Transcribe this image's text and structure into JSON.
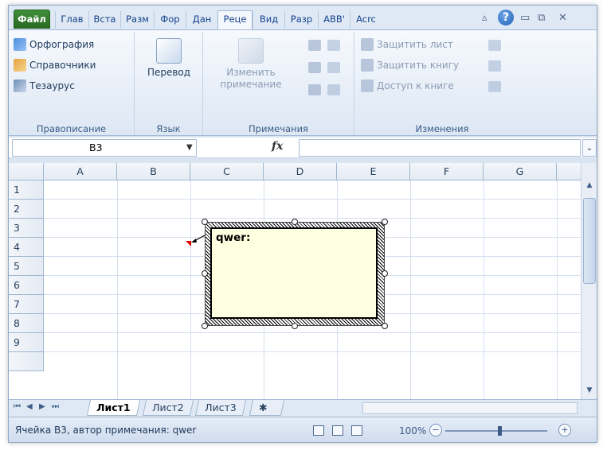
{
  "ribbon_tabs": [
    {
      "label": "Файл"
    },
    {
      "label": "Глав"
    },
    {
      "label": "Вста"
    },
    {
      "label": "Разм"
    },
    {
      "label": "Фор"
    },
    {
      "label": "Дан"
    },
    {
      "label": "Реце"
    },
    {
      "label": "Вид"
    },
    {
      "label": "Разр"
    },
    {
      "label": "ABB'"
    },
    {
      "label": "Acrc"
    }
  ],
  "active_tab": "Реце",
  "ribbon": {
    "proofing": {
      "spelling": "Орфография",
      "research": "Справочники",
      "thesaurus": "Тезаурус",
      "group_label": "Правописание"
    },
    "language": {
      "translate": "Перевод",
      "group_label": "Язык"
    },
    "comments": {
      "edit_comment_line1": "Изменить",
      "edit_comment_line2": "примечание",
      "group_label": "Примечания"
    },
    "changes": {
      "protect_sheet": "Защитить лист",
      "protect_workbook": "Защитить книгу",
      "share_workbook": "Доступ к книге",
      "group_label": "Изменения"
    }
  },
  "formula_bar": {
    "name_box": "B3",
    "fx_symbol": "fx",
    "formula": ""
  },
  "columns": [
    "A",
    "B",
    "C",
    "D",
    "E",
    "F",
    "G"
  ],
  "rows": [
    "1",
    "2",
    "3",
    "4",
    "5",
    "6",
    "7",
    "8",
    "9"
  ],
  "comment": {
    "text": "qwer:",
    "cell": "B3"
  },
  "sheet_tabs": [
    {
      "label": "Лист1",
      "active": true
    },
    {
      "label": "Лист2",
      "active": false
    },
    {
      "label": "Лист3",
      "active": false
    }
  ],
  "status_bar": {
    "text": "Ячейка B3, автор примечания: qwer",
    "zoom": "100%",
    "zoom_fraction": 0.5
  },
  "colors": {
    "accent": "#15428b",
    "file_tab": "#2f7a2a",
    "comment_fill": "#ffffe1",
    "comment_indicator": "#e00000"
  },
  "icons": [
    "help-icon",
    "minimize-icon",
    "restore-icon",
    "close-icon",
    "collapse-ribbon-icon"
  ]
}
